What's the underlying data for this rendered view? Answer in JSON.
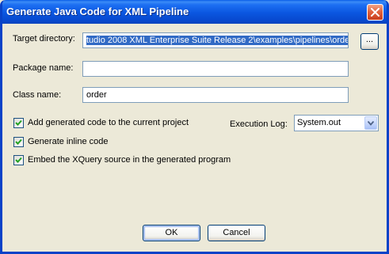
{
  "window": {
    "title": "Generate Java Code for XML Pipeline"
  },
  "form": {
    "target_directory": {
      "label": "Target directory:",
      "value": "tudio 2008 XML Enterprise Suite Release 2\\examples\\pipelines\\order",
      "browse_label": "..."
    },
    "package_name": {
      "label": "Package name:",
      "value": ""
    },
    "class_name": {
      "label": "Class name:",
      "value": "order"
    },
    "options": [
      {
        "label": "Add generated code to the current project",
        "checked": true
      },
      {
        "label": "Generate inline code",
        "checked": true
      },
      {
        "label": "Embed the XQuery source in the generated program",
        "checked": true
      }
    ],
    "execution_log": {
      "label": "Execution Log:",
      "selected": "System.out"
    }
  },
  "buttons": {
    "ok": "OK",
    "cancel": "Cancel"
  },
  "colors": {
    "title_bar": "#0a56e0",
    "dialog_face": "#ece9d8",
    "selection": "#316ac5",
    "close_button": "#e2643f"
  }
}
